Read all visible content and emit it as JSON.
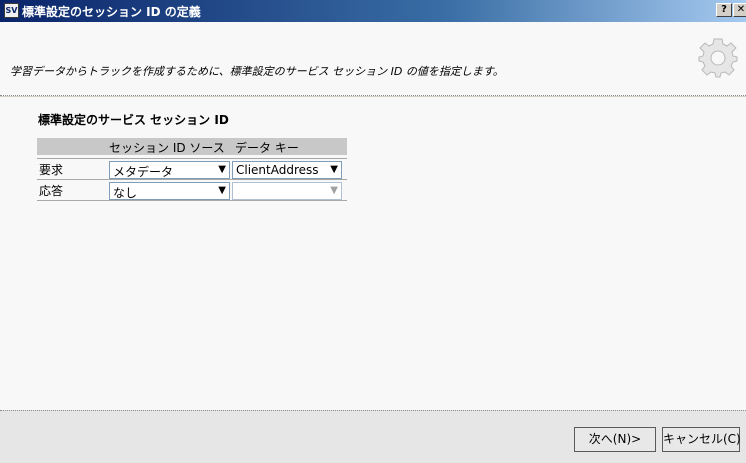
{
  "window": {
    "icon_text": "SV",
    "title": "標準設定のセッション ID の定義",
    "help_glyph": "?",
    "close_glyph": "✕"
  },
  "header": {
    "description": "学習データからトラックを作成するために、標準設定のサービス セッション ID の値を指定します。"
  },
  "section": {
    "title": "標準設定のサービス セッション ID"
  },
  "table": {
    "columns": [
      "セッション ID ソース",
      "データ キー"
    ],
    "rows": [
      {
        "label": "要求",
        "source": "メタデータ",
        "key": "ClientAddress"
      },
      {
        "label": "応答",
        "source": "なし",
        "key": ""
      }
    ]
  },
  "footer": {
    "next_label": "次へ(N)>",
    "cancel_label": "キャンセル(C)"
  }
}
